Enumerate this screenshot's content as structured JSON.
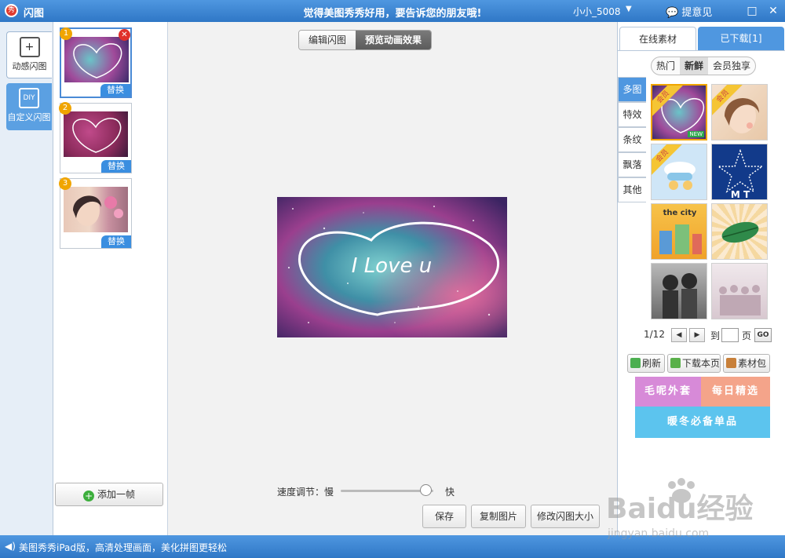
{
  "titlebar": {
    "app_icon": "秀",
    "title": "闪图",
    "slogan": "觉得美图秀秀好用，要告诉您的朋友哦!",
    "user": "小小_5008",
    "feedback": "提意见"
  },
  "leftnav": [
    {
      "label": "动感闪图",
      "icon": "+"
    },
    {
      "label": "自定义闪图",
      "icon": "DIY"
    }
  ],
  "frames": [
    {
      "num": "1",
      "replace": "替换"
    },
    {
      "num": "2",
      "replace": "替换"
    },
    {
      "num": "3",
      "replace": "替换"
    }
  ],
  "add_frame": "添加一帧",
  "main": {
    "tab_edit": "编辑闪图",
    "tab_preview": "预览动画效果",
    "preview_text": "I Love u",
    "speed_label": "速度调节：慢",
    "speed_fast": "快",
    "save": "保存",
    "copy": "复制图片",
    "resize": "修改闪图大小"
  },
  "speed": {
    "level": 0.85
  },
  "right": {
    "tab_online": "在线素材",
    "tab_downloaded": "已下载[1]",
    "subtabs": [
      "热门",
      "新鲜",
      "会员独享"
    ],
    "categories": [
      "多图",
      "特效",
      "条纹",
      "飘落",
      "其他"
    ],
    "member_ribbon": "会员",
    "new_tag": "NEW",
    "thumb_text_city": "the city",
    "thumb_text_mt": "M T",
    "pager": {
      "page": "1/12",
      "to": "到",
      "unit": "页",
      "go": "GO"
    },
    "actions": [
      "刷新",
      "下载本页",
      "素材包"
    ],
    "banners": [
      "毛呢外套",
      "每日精选",
      "暖冬必备单品"
    ]
  },
  "status": {
    "text": "美图秀秀iPad版，高清处理画面，美化拼图更轻松"
  },
  "watermark": {
    "text": "Baidu经验",
    "url": "jingyan.baidu.com"
  }
}
